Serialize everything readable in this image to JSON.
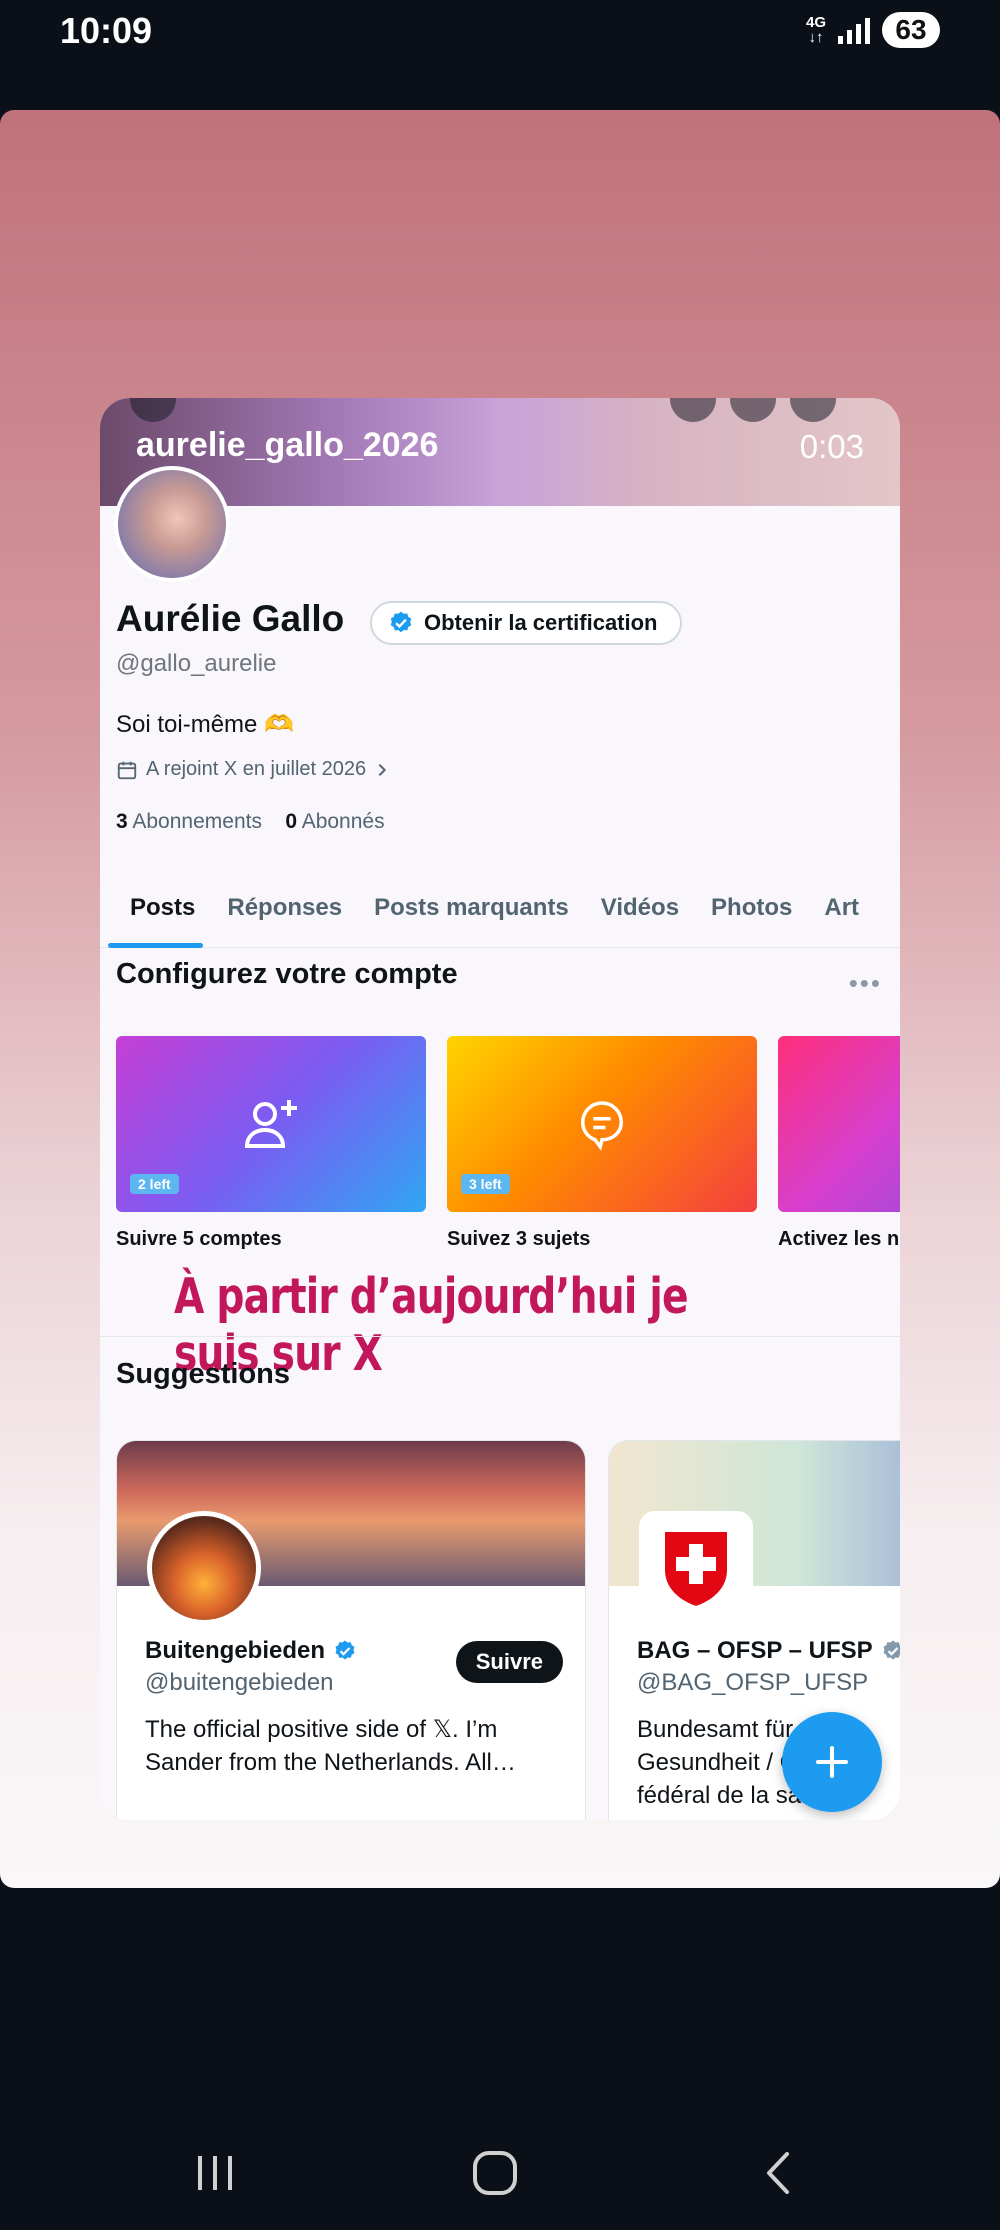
{
  "status_bar": {
    "time": "10:09",
    "network_top": "4G",
    "network_bottom": "↓↑",
    "battery": "63"
  },
  "reel": {
    "username": "aurelie_gallo_2026",
    "duration": "0:03",
    "overlay_text": "À partir d’aujourd’hui je suis sur X"
  },
  "profile": {
    "name": "Aurélie Gallo",
    "certification_label": "Obtenir la certification",
    "handle": "@gallo_aurelie",
    "bio": "Soi toi-même 🫶",
    "joined": "A rejoint X en juillet 2026",
    "following_count": "3",
    "following_label": "Abonnements",
    "followers_count": "0",
    "followers_label": "Abonnés"
  },
  "tabs": [
    "Posts",
    "Réponses",
    "Posts marquants",
    "Vidéos",
    "Photos",
    "Art"
  ],
  "setup": {
    "title": "Configurez votre compte",
    "more": "•••",
    "cards": [
      {
        "label": "Suivre 5 comptes",
        "pill": "2 left",
        "icon": "add-user-icon"
      },
      {
        "label": "Suivez 3 sujets",
        "pill": "3 left",
        "icon": "topic-icon"
      },
      {
        "label": "Activez les n",
        "pill": "",
        "icon": ""
      }
    ]
  },
  "suggestions": {
    "title": "Suggestions",
    "items": [
      {
        "name": "Buitengebieden",
        "handle": "@buitengebieden",
        "bio": "The official positive side of 𝕏. I’m Sander from the Netherlands. All…",
        "follow_label": "Suivre"
      },
      {
        "name": "BAG – OFSP – UFSP",
        "handle": "@BAG_OFSP_UFSP",
        "bio": "Bundesamt für Gesundheit / Office fédéral de la santé"
      }
    ]
  },
  "colors": {
    "accent": "#1d9bf0",
    "overlay_text": "#c2185b"
  }
}
